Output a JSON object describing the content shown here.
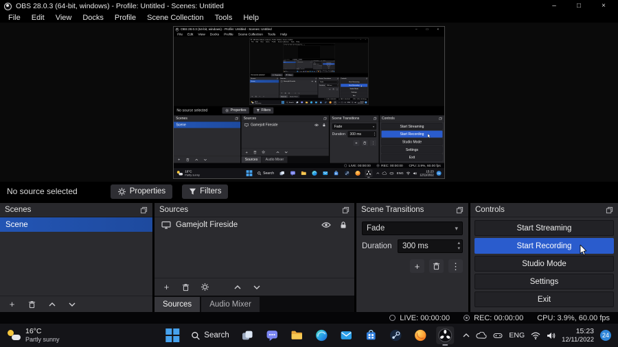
{
  "window": {
    "title": "OBS 28.0.3 (64-bit, windows) - Profile: Untitled - Scenes: Untitled"
  },
  "icons": {
    "minimize": "–",
    "maximize": "□",
    "close": "×",
    "plus": "+",
    "dots_vertical": "⋮",
    "dropdown": "▾",
    "spin_up": "▴",
    "spin_down": "▾"
  },
  "menu": {
    "items": [
      "File",
      "Edit",
      "View",
      "Docks",
      "Profile",
      "Scene Collection",
      "Tools",
      "Help"
    ]
  },
  "source_toolbar": {
    "status": "No source selected",
    "properties": "Properties",
    "filters": "Filters"
  },
  "scenes": {
    "title": "Scenes",
    "rows": [
      {
        "name": "Scene",
        "selected": true
      }
    ]
  },
  "sources": {
    "title": "Sources",
    "rows": [
      {
        "name": "Gamejolt Fireside"
      }
    ],
    "tabs": {
      "sources": "Sources",
      "audio_mixer": "Audio Mixer"
    }
  },
  "transitions": {
    "title": "Scene Transitions",
    "selected": "Fade",
    "duration_label": "Duration",
    "duration_value": "300 ms"
  },
  "controls": {
    "title": "Controls",
    "start_streaming": "Start Streaming",
    "start_recording": "Start Recording",
    "studio_mode": "Studio Mode",
    "settings": "Settings",
    "exit": "Exit",
    "active_button": "Start Recording"
  },
  "status_bar": {
    "live": "LIVE: 00:00:00",
    "rec": "REC: 00:00:00",
    "cpu": "CPU: 3.9%, 60.00 fps"
  },
  "taskbar": {
    "weather_temp": "16°C",
    "weather_condition": "Partly sunny",
    "search": "Search",
    "language": "ENG",
    "time": "15:23",
    "date": "12/11/2022",
    "badge": "24"
  },
  "colors": {
    "scene_selected": "#2355b4",
    "record_button": "#2a5ccd",
    "taskbar_badge": "#2f86d9",
    "windows_blue": "#46a2ee"
  }
}
